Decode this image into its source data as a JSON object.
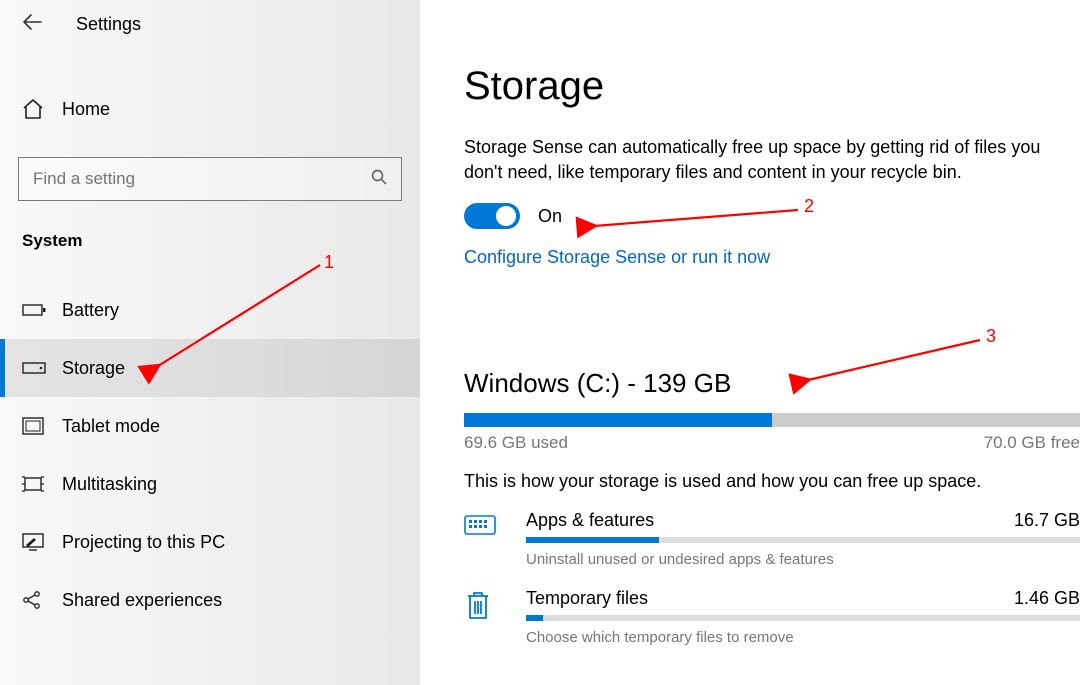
{
  "header": {
    "back": "←",
    "title": "Settings"
  },
  "sidebar": {
    "home": "Home",
    "search_placeholder": "Find a setting",
    "category": "System",
    "items": [
      {
        "id": "battery",
        "label": "Battery",
        "selected": false
      },
      {
        "id": "storage",
        "label": "Storage",
        "selected": true
      },
      {
        "id": "tablet-mode",
        "label": "Tablet mode",
        "selected": false
      },
      {
        "id": "multitask",
        "label": "Multitasking",
        "selected": false
      },
      {
        "id": "projecting",
        "label": "Projecting to this PC",
        "selected": false
      },
      {
        "id": "shared",
        "label": "Shared experiences",
        "selected": false
      }
    ]
  },
  "storage": {
    "title": "Storage",
    "description": "Storage Sense can automatically free up space by getting rid of files you don't need, like temporary files and content in your recycle bin.",
    "toggle_state": "On",
    "configure_link": "Configure Storage Sense or run it now",
    "drive_title": "Windows (C:) - 139 GB",
    "used_label": "69.6 GB used",
    "free_label": "70.0 GB free",
    "used_percent": 50,
    "summary": "This is how your storage is used and how you can free up space.",
    "categories": [
      {
        "id": "apps",
        "name": "Apps & features",
        "size": "16.7 GB",
        "percent": 24,
        "hint": "Uninstall unused or undesired apps & features"
      },
      {
        "id": "temp",
        "name": "Temporary files",
        "size": "1.46 GB",
        "percent": 3,
        "hint": "Choose which temporary files to remove"
      }
    ]
  },
  "annotations": {
    "a1": "1",
    "a2": "2",
    "a3": "3"
  }
}
